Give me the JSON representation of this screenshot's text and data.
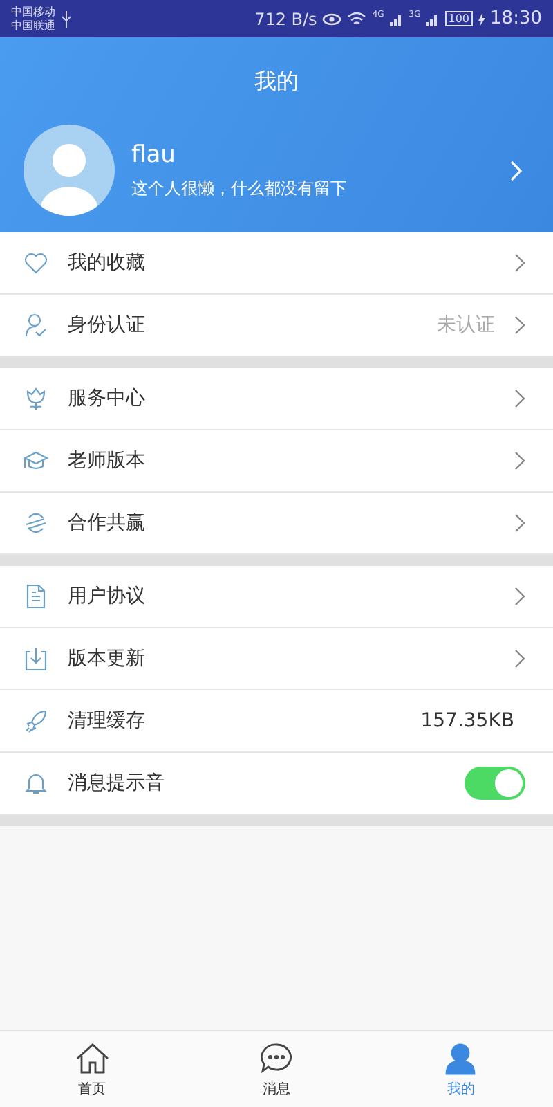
{
  "status_bar": {
    "carrier_1": "中国移动",
    "carrier_2": "中国联通",
    "speed": "712 B/s",
    "network_1": "4G",
    "network_2": "3G",
    "battery": "100",
    "time": "18:30"
  },
  "header": {
    "title": "我的"
  },
  "profile": {
    "name": "flau",
    "bio": "这个人很懒，什么都没有留下"
  },
  "groups": [
    {
      "rows": [
        {
          "kind": "link",
          "label": "我的收藏"
        },
        {
          "kind": "link",
          "label": "身份认证",
          "value": "未认证"
        }
      ]
    },
    {
      "rows": [
        {
          "kind": "link",
          "label": "服务中心"
        },
        {
          "kind": "link",
          "label": "老师版本"
        },
        {
          "kind": "link",
          "label": "合作共赢"
        }
      ]
    },
    {
      "rows": [
        {
          "kind": "link",
          "label": "用户协议"
        },
        {
          "kind": "link",
          "label": "版本更新"
        },
        {
          "kind": "value",
          "label": "清理缓存",
          "value": "157.35KB"
        },
        {
          "kind": "toggle",
          "label": "消息提示音",
          "on": true
        }
      ]
    }
  ],
  "tabs": [
    {
      "label": "首页",
      "selected": false
    },
    {
      "label": "消息",
      "selected": false
    },
    {
      "label": "我的",
      "selected": true
    }
  ]
}
